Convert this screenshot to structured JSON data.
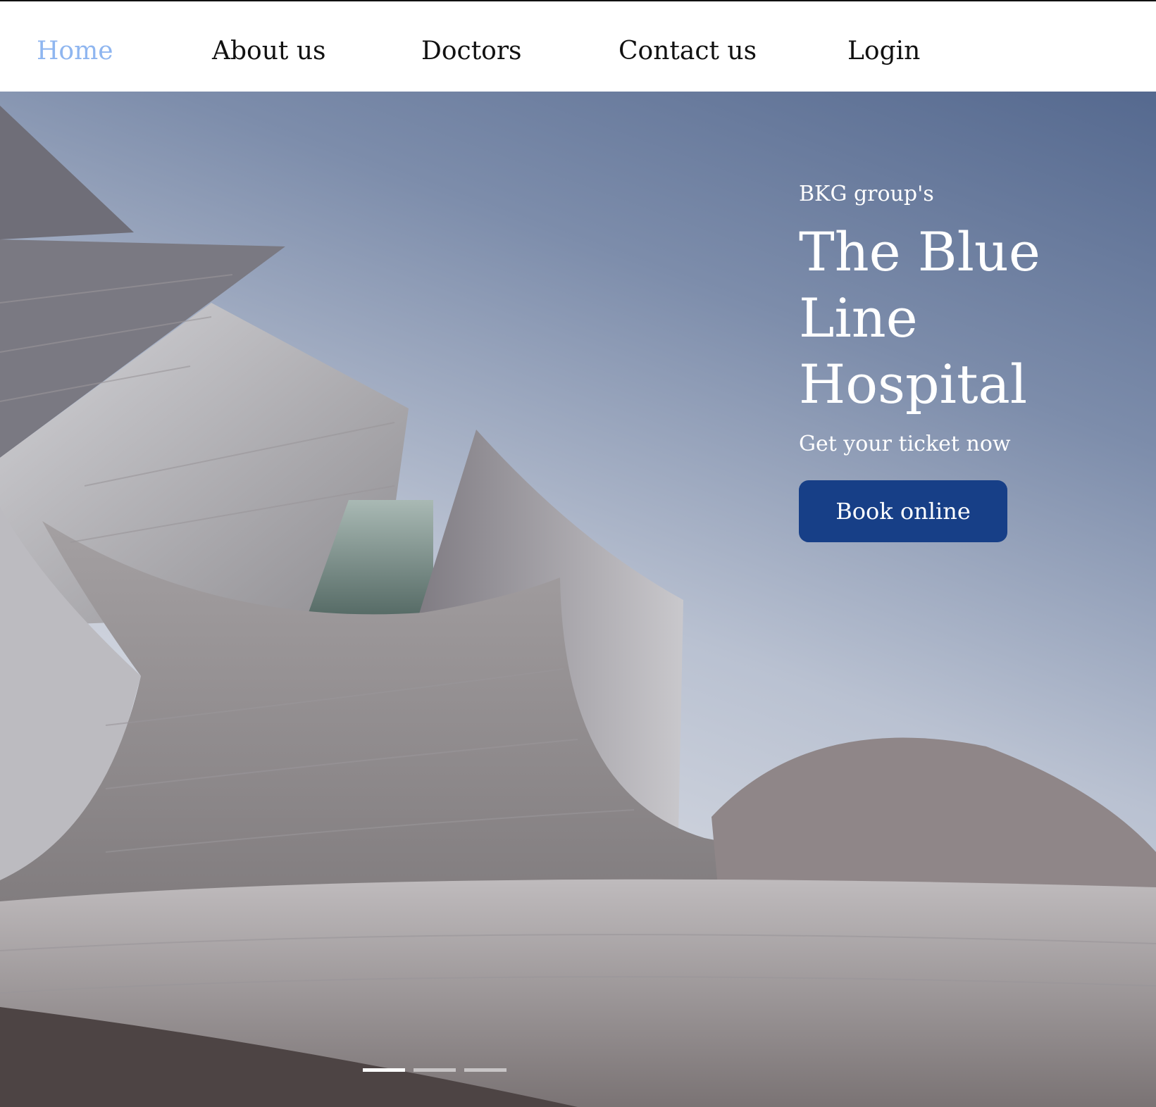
{
  "nav": {
    "items": [
      {
        "label": "Home",
        "active": true
      },
      {
        "label": "About us",
        "active": false
      },
      {
        "label": "Doctors",
        "active": false
      },
      {
        "label": "Contact us",
        "active": false
      },
      {
        "label": "Login",
        "active": false
      }
    ],
    "active_color": "#8fb6f0"
  },
  "hero": {
    "kicker": "BKG group's",
    "title": "The Blue Line Hospital",
    "subtitle": "Get your ticket now",
    "cta_label": "Book online",
    "cta_color": "#173f87",
    "image_description_icon": "building-photo",
    "carousel": {
      "slide_count": 3,
      "active_index": 0
    }
  }
}
